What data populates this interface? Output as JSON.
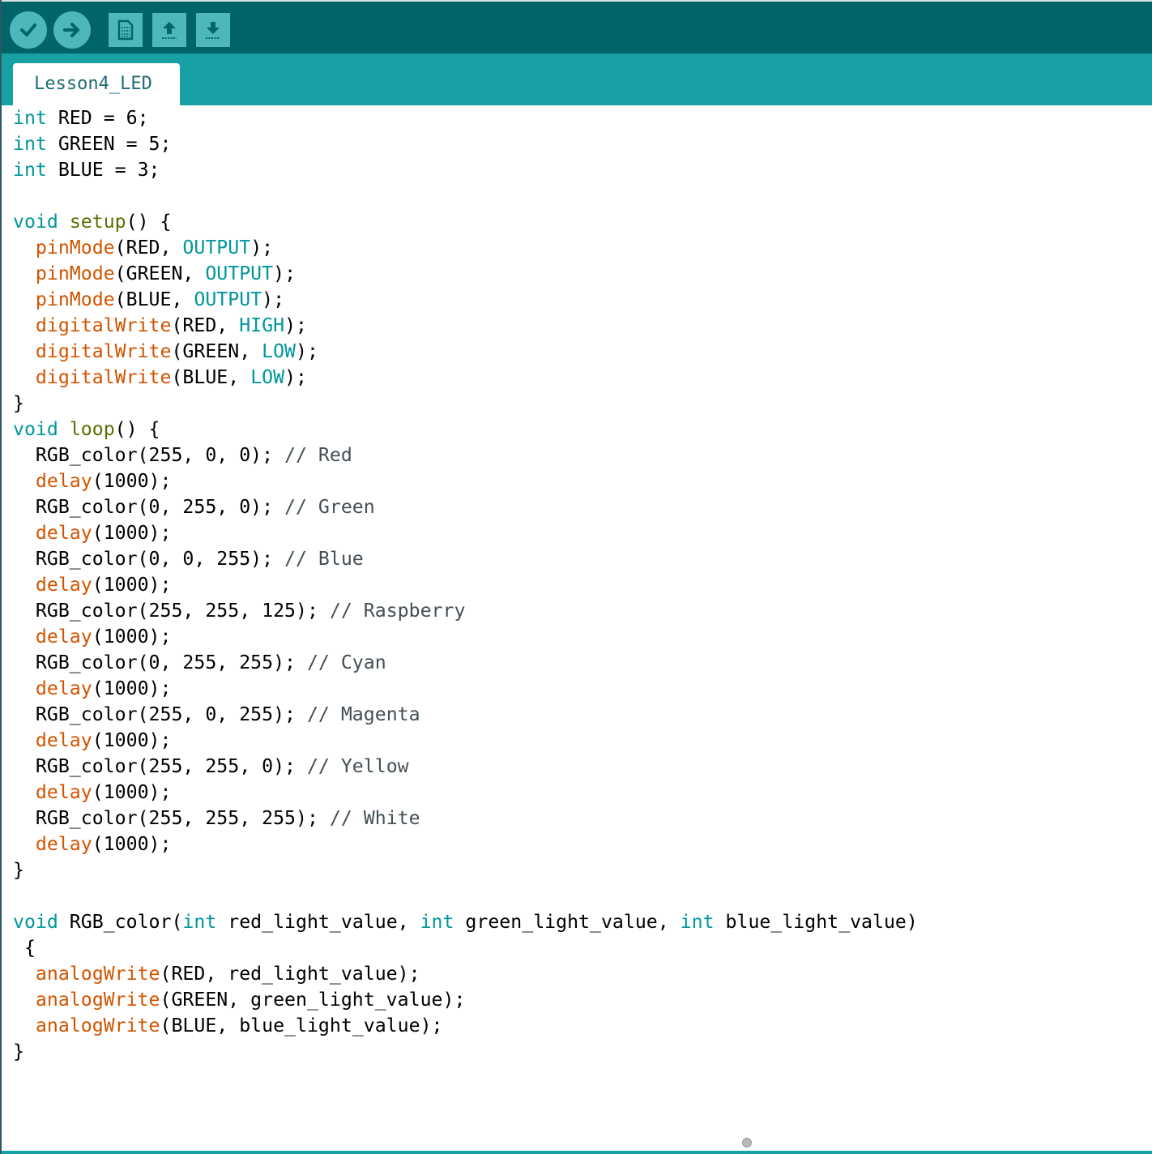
{
  "toolbar": {
    "buttons": [
      {
        "name": "verify",
        "icon": "checkmark-icon"
      },
      {
        "name": "upload",
        "icon": "arrow-right-icon"
      },
      {
        "name": "new",
        "icon": "document-icon"
      },
      {
        "name": "open",
        "icon": "arrow-up-icon"
      },
      {
        "name": "save",
        "icon": "arrow-down-icon"
      }
    ]
  },
  "tabs": [
    {
      "label": "Lesson4_LED",
      "active": true
    }
  ],
  "colors": {
    "toolbar_bg": "#006468",
    "tabbar_bg": "#17a1a5",
    "button_bg": "#4db7bb",
    "keyword": "#00979c",
    "function": "#d35400",
    "definition": "#5e6d03",
    "comment": "#434f54"
  },
  "code": {
    "lines": [
      [
        {
          "t": "int",
          "c": "kw"
        },
        {
          "t": " RED = 6;"
        }
      ],
      [
        {
          "t": "int",
          "c": "kw"
        },
        {
          "t": " GREEN = 5;"
        }
      ],
      [
        {
          "t": "int",
          "c": "kw"
        },
        {
          "t": " BLUE = 3;"
        }
      ],
      [],
      [
        {
          "t": "void",
          "c": "kw"
        },
        {
          "t": " "
        },
        {
          "t": "setup",
          "c": "def"
        },
        {
          "t": "() {"
        }
      ],
      [
        {
          "t": "  "
        },
        {
          "t": "pinMode",
          "c": "fn"
        },
        {
          "t": "(RED, "
        },
        {
          "t": "OUTPUT",
          "c": "kw"
        },
        {
          "t": ");"
        }
      ],
      [
        {
          "t": "  "
        },
        {
          "t": "pinMode",
          "c": "fn"
        },
        {
          "t": "(GREEN, "
        },
        {
          "t": "OUTPUT",
          "c": "kw"
        },
        {
          "t": ");"
        }
      ],
      [
        {
          "t": "  "
        },
        {
          "t": "pinMode",
          "c": "fn"
        },
        {
          "t": "(BLUE, "
        },
        {
          "t": "OUTPUT",
          "c": "kw"
        },
        {
          "t": ");"
        }
      ],
      [
        {
          "t": "  "
        },
        {
          "t": "digitalWrite",
          "c": "fn"
        },
        {
          "t": "(RED, "
        },
        {
          "t": "HIGH",
          "c": "kw"
        },
        {
          "t": ");"
        }
      ],
      [
        {
          "t": "  "
        },
        {
          "t": "digitalWrite",
          "c": "fn"
        },
        {
          "t": "(GREEN, "
        },
        {
          "t": "LOW",
          "c": "kw"
        },
        {
          "t": ");"
        }
      ],
      [
        {
          "t": "  "
        },
        {
          "t": "digitalWrite",
          "c": "fn"
        },
        {
          "t": "(BLUE, "
        },
        {
          "t": "LOW",
          "c": "kw"
        },
        {
          "t": ");"
        }
      ],
      [
        {
          "t": "}"
        }
      ],
      [
        {
          "t": "void",
          "c": "kw"
        },
        {
          "t": " "
        },
        {
          "t": "loop",
          "c": "def"
        },
        {
          "t": "() {"
        }
      ],
      [
        {
          "t": "  RGB_color(255, 0, 0); "
        },
        {
          "t": "// Red",
          "c": "cm"
        }
      ],
      [
        {
          "t": "  "
        },
        {
          "t": "delay",
          "c": "fn"
        },
        {
          "t": "(1000);"
        }
      ],
      [
        {
          "t": "  RGB_color(0, 255, 0); "
        },
        {
          "t": "// Green",
          "c": "cm"
        }
      ],
      [
        {
          "t": "  "
        },
        {
          "t": "delay",
          "c": "fn"
        },
        {
          "t": "(1000);"
        }
      ],
      [
        {
          "t": "  RGB_color(0, 0, 255); "
        },
        {
          "t": "// Blue",
          "c": "cm"
        }
      ],
      [
        {
          "t": "  "
        },
        {
          "t": "delay",
          "c": "fn"
        },
        {
          "t": "(1000);"
        }
      ],
      [
        {
          "t": "  RGB_color(255, 255, 125); "
        },
        {
          "t": "// Raspberry",
          "c": "cm"
        }
      ],
      [
        {
          "t": "  "
        },
        {
          "t": "delay",
          "c": "fn"
        },
        {
          "t": "(1000);"
        }
      ],
      [
        {
          "t": "  RGB_color(0, 255, 255); "
        },
        {
          "t": "// Cyan",
          "c": "cm"
        }
      ],
      [
        {
          "t": "  "
        },
        {
          "t": "delay",
          "c": "fn"
        },
        {
          "t": "(1000);"
        }
      ],
      [
        {
          "t": "  RGB_color(255, 0, 255); "
        },
        {
          "t": "// Magenta",
          "c": "cm"
        }
      ],
      [
        {
          "t": "  "
        },
        {
          "t": "delay",
          "c": "fn"
        },
        {
          "t": "(1000);"
        }
      ],
      [
        {
          "t": "  RGB_color(255, 255, 0); "
        },
        {
          "t": "// Yellow",
          "c": "cm"
        }
      ],
      [
        {
          "t": "  "
        },
        {
          "t": "delay",
          "c": "fn"
        },
        {
          "t": "(1000);"
        }
      ],
      [
        {
          "t": "  RGB_color(255, 255, 255); "
        },
        {
          "t": "// White",
          "c": "cm"
        }
      ],
      [
        {
          "t": "  "
        },
        {
          "t": "delay",
          "c": "fn"
        },
        {
          "t": "(1000);"
        }
      ],
      [
        {
          "t": "}"
        }
      ],
      [],
      [
        {
          "t": "void",
          "c": "kw"
        },
        {
          "t": " RGB_color("
        },
        {
          "t": "int",
          "c": "kw"
        },
        {
          "t": " red_light_value, "
        },
        {
          "t": "int",
          "c": "kw"
        },
        {
          "t": " green_light_value, "
        },
        {
          "t": "int",
          "c": "kw"
        },
        {
          "t": " blue_light_value)"
        }
      ],
      [
        {
          "t": " {"
        }
      ],
      [
        {
          "t": "  "
        },
        {
          "t": "analogWrite",
          "c": "fn"
        },
        {
          "t": "(RED, red_light_value);"
        }
      ],
      [
        {
          "t": "  "
        },
        {
          "t": "analogWrite",
          "c": "fn"
        },
        {
          "t": "(GREEN, green_light_value);"
        }
      ],
      [
        {
          "t": "  "
        },
        {
          "t": "analogWrite",
          "c": "fn"
        },
        {
          "t": "(BLUE, blue_light_value);"
        }
      ],
      [
        {
          "t": "}"
        }
      ]
    ]
  }
}
